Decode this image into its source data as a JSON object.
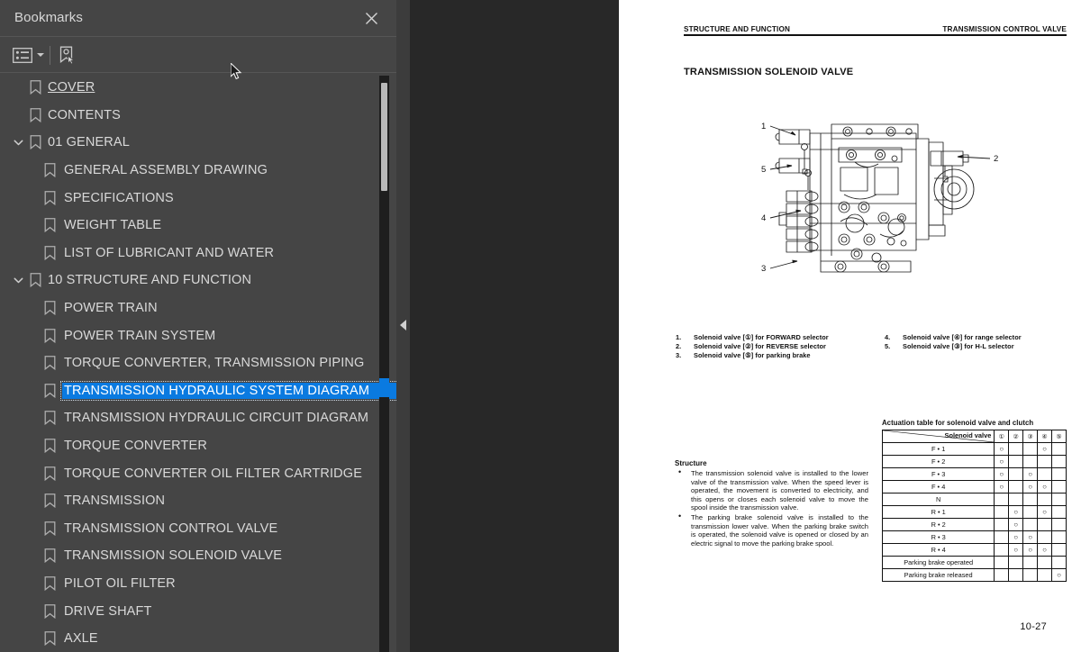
{
  "sidebar": {
    "title": "Bookmarks",
    "close_icon": "close-icon",
    "toolbar": {
      "options_icon": "list-options-icon",
      "options_caret_icon": "chevron-down-icon",
      "new_bookmark_icon": "new-bookmark-icon"
    },
    "bookmarks": [
      {
        "label": "COVER",
        "depth": 0,
        "expandable": false,
        "selected": false,
        "underline": true
      },
      {
        "label": "CONTENTS",
        "depth": 0,
        "expandable": false,
        "selected": false,
        "underline": false
      },
      {
        "label": "01 GENERAL",
        "depth": 0,
        "expandable": true,
        "expanded": true,
        "selected": false,
        "underline": false
      },
      {
        "label": "GENERAL ASSEMBLY DRAWING",
        "depth": 1,
        "expandable": false,
        "selected": false,
        "underline": false
      },
      {
        "label": "SPECIFICATIONS",
        "depth": 1,
        "expandable": false,
        "selected": false,
        "underline": false
      },
      {
        "label": "WEIGHT TABLE",
        "depth": 1,
        "expandable": false,
        "selected": false,
        "underline": false
      },
      {
        "label": "LIST OF LUBRICANT AND WATER",
        "depth": 1,
        "expandable": false,
        "selected": false,
        "underline": false
      },
      {
        "label": "10 STRUCTURE AND FUNCTION",
        "depth": 0,
        "expandable": true,
        "expanded": true,
        "selected": false,
        "underline": false
      },
      {
        "label": "POWER TRAIN",
        "depth": 1,
        "expandable": false,
        "selected": false,
        "underline": false
      },
      {
        "label": "POWER TRAIN SYSTEM",
        "depth": 1,
        "expandable": false,
        "selected": false,
        "underline": false
      },
      {
        "label": "TORQUE CONVERTER, TRANSMISSION PIPING",
        "depth": 1,
        "expandable": false,
        "selected": false,
        "underline": false
      },
      {
        "label": "TRANSMISSION HYDRAULIC SYSTEM DIAGRAM",
        "depth": 1,
        "expandable": false,
        "selected": true,
        "underline": false
      },
      {
        "label": "TRANSMISSION HYDRAULIC CIRCUIT DIAGRAM",
        "depth": 1,
        "expandable": false,
        "selected": false,
        "underline": false
      },
      {
        "label": "TORQUE CONVERTER",
        "depth": 1,
        "expandable": false,
        "selected": false,
        "underline": false
      },
      {
        "label": "TORQUE CONVERTER OIL FILTER CARTRIDGE",
        "depth": 1,
        "expandable": false,
        "selected": false,
        "underline": false
      },
      {
        "label": "TRANSMISSION",
        "depth": 1,
        "expandable": false,
        "selected": false,
        "underline": false
      },
      {
        "label": "TRANSMISSION CONTROL VALVE",
        "depth": 1,
        "expandable": false,
        "selected": false,
        "underline": false
      },
      {
        "label": "TRANSMISSION SOLENOID VALVE",
        "depth": 1,
        "expandable": false,
        "selected": false,
        "underline": false
      },
      {
        "label": "PILOT OIL FILTER",
        "depth": 1,
        "expandable": false,
        "selected": false,
        "underline": false
      },
      {
        "label": "DRIVE SHAFT",
        "depth": 1,
        "expandable": false,
        "selected": false,
        "underline": false
      },
      {
        "label": "AXLE",
        "depth": 1,
        "expandable": false,
        "selected": false,
        "underline": false
      }
    ],
    "selection_color": "#0a7ae0",
    "background_color": "#454545"
  },
  "splitter": {
    "collapse_icon": "collapse-left-arrow-icon"
  },
  "document": {
    "header_left": "STRUCTURE AND FUNCTION",
    "header_right": "TRANSMISSION CONTROL VALVE",
    "title": "TRANSMISSION SOLENOID VALVE",
    "page_number": "10-27",
    "figure": {
      "callouts": [
        "1",
        "2",
        "3",
        "4",
        "5"
      ]
    },
    "legend": {
      "column_a": [
        {
          "num": "1.",
          "text": "Solenoid valve [①] for FORWARD selector"
        },
        {
          "num": "2.",
          "text": "Solenoid valve [②] for REVERSE selector"
        },
        {
          "num": "3.",
          "text": "Solenoid valve [⑤] for parking brake"
        }
      ],
      "column_b": [
        {
          "num": "4.",
          "text": "Solenoid valve [④] for range selector"
        },
        {
          "num": "5.",
          "text": "Solenoid valve [③] for H-L selector"
        }
      ]
    },
    "structure": {
      "heading": "Structure",
      "bullets": [
        "The transmission solenoid valve is installed to the lower valve of the transmission valve. When the speed lever is operated, the movement is converted to electricity, and this opens or closes each solenoid valve to move the spool inside the transmission valve.",
        "The parking brake solenoid valve is installed to the transmission lower valve. When the parking brake switch is operated, the solenoid valve is opened or closed by an electric signal to move the parking brake spool."
      ]
    },
    "actuation_table": {
      "caption": "Actuation table for solenoid valve and clutch",
      "corner_label": "Solenoid valve",
      "columns": [
        "①",
        "②",
        "③",
        "④",
        "⑤"
      ],
      "rows": [
        {
          "label": "F • 1",
          "marks": [
            true,
            false,
            false,
            true,
            false
          ]
        },
        {
          "label": "F • 2",
          "marks": [
            true,
            false,
            false,
            false,
            false
          ]
        },
        {
          "label": "F • 3",
          "marks": [
            true,
            false,
            true,
            false,
            false
          ]
        },
        {
          "label": "F • 4",
          "marks": [
            true,
            false,
            true,
            true,
            false
          ]
        },
        {
          "label": "N",
          "marks": [
            false,
            false,
            false,
            false,
            false
          ]
        },
        {
          "label": "R • 1",
          "marks": [
            false,
            true,
            false,
            true,
            false
          ]
        },
        {
          "label": "R • 2",
          "marks": [
            false,
            true,
            false,
            false,
            false
          ]
        },
        {
          "label": "R • 3",
          "marks": [
            false,
            true,
            true,
            false,
            false
          ]
        },
        {
          "label": "R • 4",
          "marks": [
            false,
            true,
            true,
            true,
            false
          ]
        },
        {
          "label": "Parking brake operated",
          "marks": [
            false,
            false,
            false,
            false,
            false
          ]
        },
        {
          "label": "Parking brake released",
          "marks": [
            false,
            false,
            false,
            false,
            true
          ]
        }
      ],
      "mark_glyph": "○"
    }
  },
  "cursor": {
    "icon": "mouse-pointer-icon"
  }
}
